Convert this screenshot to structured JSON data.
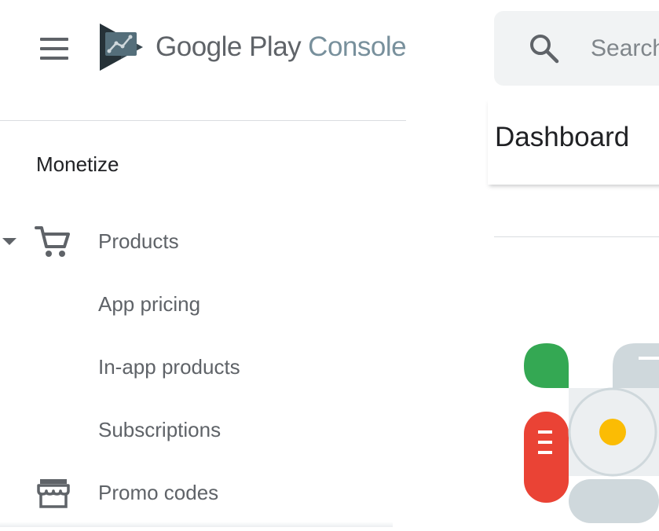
{
  "header": {
    "menu_icon": "hamburger-menu-icon",
    "brand_google_play": "Google Play",
    "brand_console": "Console",
    "logo_icon": "play-console-logo-icon"
  },
  "sidebar": {
    "section_title": "Monetize",
    "items": [
      {
        "label": "Products",
        "icon": "shopping-cart-icon",
        "expanded": true
      },
      {
        "label": "App pricing"
      },
      {
        "label": "In-app products"
      },
      {
        "label": "Subscriptions"
      },
      {
        "label": "Promo codes",
        "icon": "storefront-icon"
      }
    ]
  },
  "search": {
    "placeholder": "Search",
    "icon": "search-icon"
  },
  "main": {
    "page_title": "Dashboard"
  },
  "colors": {
    "text_primary": "#202124",
    "text_secondary": "#5f6368",
    "brand_console": "#78909c",
    "search_bg": "#f1f3f4",
    "divider": "#dadce0",
    "illus_green": "#34a853",
    "illus_red": "#ea4335",
    "illus_yellow": "#fbbc04",
    "illus_grey": "#cfd8dc"
  }
}
